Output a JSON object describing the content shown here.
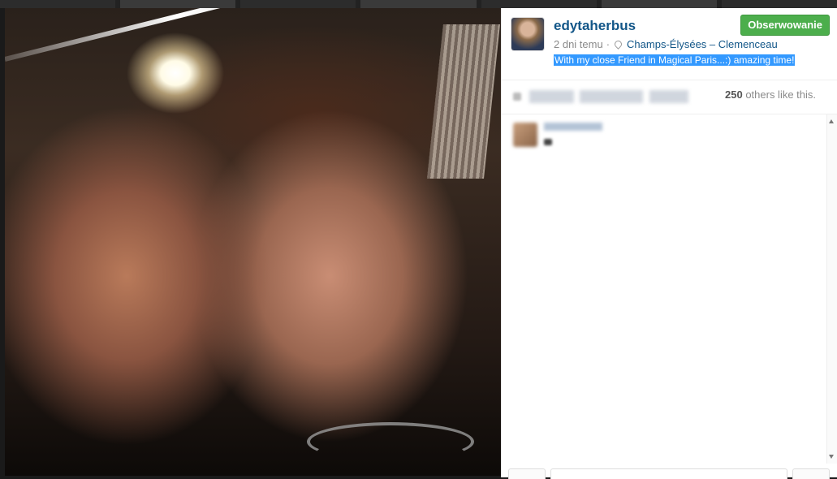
{
  "post": {
    "username": "edytaherbus",
    "follow_label": "Obserwowanie",
    "time_ago": "2 dni temu",
    "separator": "·",
    "location": "Champs-Élysées – Clemenceau",
    "caption": "With my close Friend in Magical Paris...:) amazing time!"
  },
  "likes": {
    "count": "250",
    "suffix": " others like this."
  },
  "colors": {
    "username": "#125688",
    "follow_button": "#4cae4c",
    "caption_highlight": "#3399ff"
  },
  "icons": {
    "location": "map-pin-icon",
    "like": "heart-icon"
  }
}
